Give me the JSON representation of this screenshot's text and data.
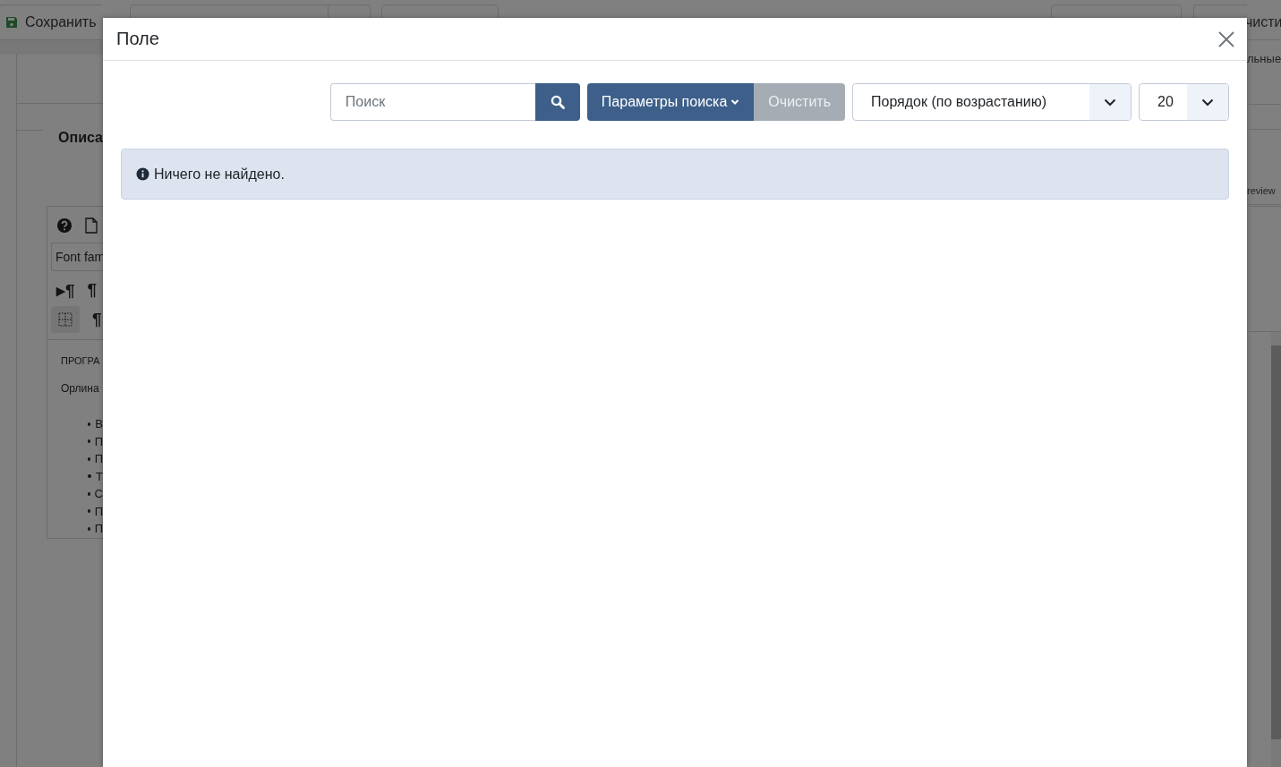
{
  "background": {
    "save_button": "Сохранить",
    "right_button": "чисти",
    "tab_label": "льные",
    "legend": "Описа",
    "preview_tab": "review",
    "editor": {
      "font_select": "Font fam",
      "toolbar_rows": [
        [
          "▸¶",
          "¶"
        ],
        [
          "¶"
        ]
      ],
      "paragraphs": [
        "ПРОГРА",
        "Орлина"
      ],
      "bullets": [
        "В",
        "П",
        "П",
        "Т",
        "С",
        "П",
        "П"
      ]
    }
  },
  "modal": {
    "title": "Поле",
    "search": {
      "placeholder": "Поиск"
    },
    "options_button": "Параметры поиска",
    "clear_button": {
      "label": "Очистить",
      "disabled": true
    },
    "ordering": "Порядок (по возрастанию)",
    "limit": "20",
    "message": "Ничего не найдено."
  }
}
